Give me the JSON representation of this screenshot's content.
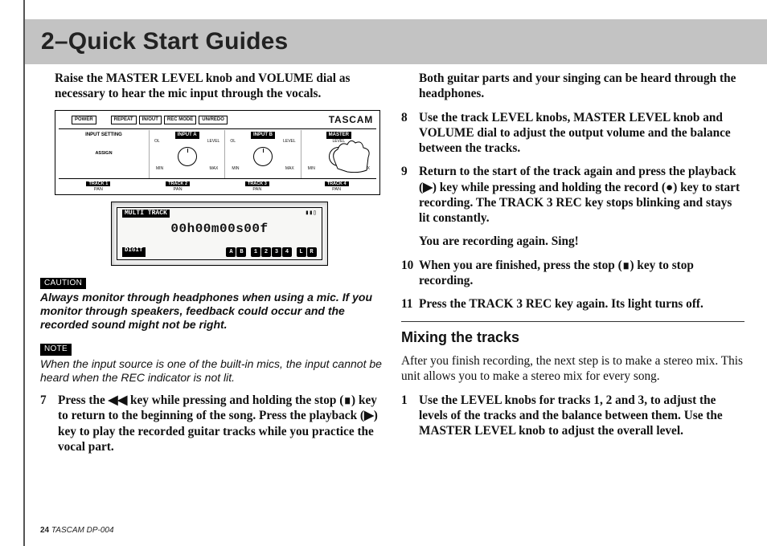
{
  "header": {
    "title": "2–Quick Start Guides"
  },
  "left": {
    "intro": "Raise the MASTER LEVEL knob and VOLUME dial as necessary to hear the mic input through the vocals.",
    "diagram": {
      "btn_power": "POWER",
      "btn_repeat": "REPEAT",
      "btn_inout": "IN/OUT",
      "btn_recmode": "REC MODE",
      "btn_unredo": "UN/REDO",
      "brand": "TASCAM",
      "input_setting": "INPUT SETTING",
      "input_a": "INPUT A",
      "input_b": "INPUT B",
      "master": "MASTER",
      "assign": "ASSIGN",
      "ol": "OL",
      "level": "LEVEL",
      "min": "MIN",
      "max": "MAX",
      "track1": "TRACK 1",
      "track2": "TRACK 2",
      "track3": "TRACK 3",
      "track4": "TRACK 4",
      "pan": "PAN"
    },
    "lcd": {
      "mode": "MULTI TRACK",
      "batt": "▮▮▯",
      "time": "00h00m00s00f",
      "digit": "DIGIT",
      "ab": "A B",
      "seq": "1 2 3 4",
      "lr": "L R"
    },
    "caution_label": "CAUTION",
    "caution_text": "Always monitor through headphones when using a mic. If you monitor through speakers, feedback could occur and the recorded sound might not be right.",
    "note_label": "NOTE",
    "note_text": "When the input source is one of the built-in mics, the input cannot be heard when the REC indicator is not lit.",
    "step7_num": "7",
    "step7": "Press the ◀◀ key while pressing and holding the stop (∎) key to return to the beginning of the song. Press the playback (▶) key to play the recorded guitar tracks while you practice the vocal part."
  },
  "right": {
    "cont": "Both guitar parts and your singing can be heard through the headphones.",
    "s8_num": "8",
    "s8": "Use the track LEVEL knobs, MASTER LEVEL knob and VOLUME dial to adjust the output volume and the balance between the tracks.",
    "s9_num": "9",
    "s9a": "Return to the start of the track again and press the playback (▶) key while pressing and holding the record (●) key to start recording. The TRACK 3 REC key stops blinking and stays lit constantly.",
    "s9b": "You are recording again. Sing!",
    "s10_num": "10",
    "s10": "When you are finished, press the stop (∎) key to stop recording.",
    "s11_num": "11",
    "s11": "Press the TRACK 3 REC key again. Its light turns off.",
    "section": "Mixing the tracks",
    "mix_intro": "After you finish recording, the next step is to make a stereo mix. This unit allows you to make a stereo mix for every song.",
    "m1_num": "1",
    "m1": "Use the LEVEL knobs for tracks 1, 2 and 3, to adjust the levels of the tracks and the balance between them. Use the MASTER LEVEL knob to adjust the overall level."
  },
  "footer": {
    "page": "24",
    "model": "TASCAM  DP-004"
  }
}
